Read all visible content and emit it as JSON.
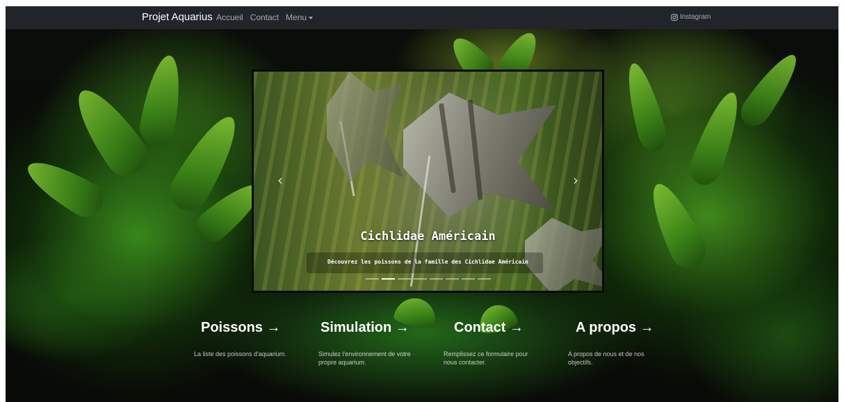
{
  "navbar": {
    "brand": "Projet Aquarius",
    "links": [
      {
        "label": "Accueil"
      },
      {
        "label": "Contact"
      },
      {
        "label": "Menu"
      }
    ],
    "instagram": {
      "label": "Instagram",
      "icon": "instagram-icon"
    }
  },
  "carousel": {
    "title": "Cichlidae Américain",
    "caption": "Découvrez les poissons de la famille des Cichlidae Américain",
    "slide_count": 8,
    "active_index": 1,
    "prev_icon": "chevron-left-icon",
    "next_icon": "chevron-right-icon"
  },
  "features": [
    {
      "title": "Poissons →",
      "text": "La liste des poissons d'aquarium."
    },
    {
      "title": "Simulation →",
      "text": "Simulez l'environnement de votre propre aquarium."
    },
    {
      "title": "Contact →",
      "text": "Remplissez ce formulaire pour nous contacter."
    },
    {
      "title": "A propos →",
      "text": "A propos de nous et de nos objectifs."
    }
  ],
  "colors": {
    "navbar_bg": "#212529",
    "nav_text": "#ffffff99",
    "page_bg": "#070a06"
  }
}
